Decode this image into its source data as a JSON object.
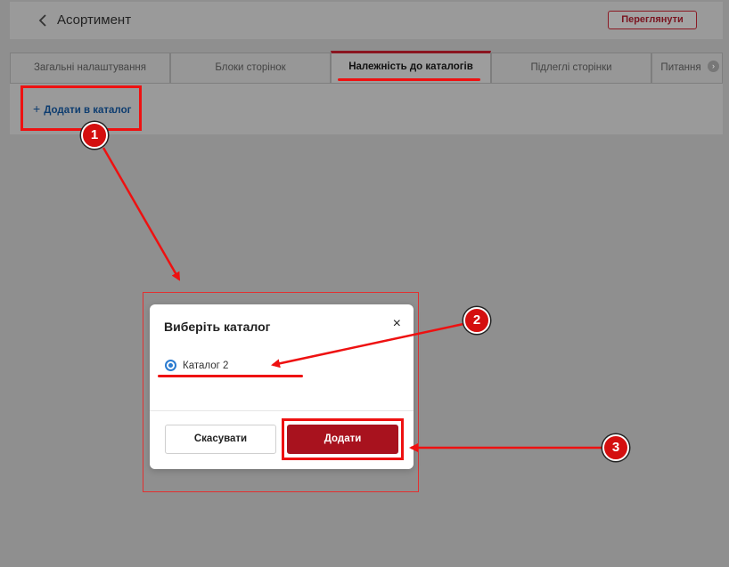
{
  "header": {
    "title": "Асортимент",
    "back_icon": "chevron-left-icon",
    "preview_label": "Переглянути"
  },
  "tabs": [
    {
      "label": "Загальні налаштування",
      "active": false
    },
    {
      "label": "Блоки сторінок",
      "active": false
    },
    {
      "label": "Належність до каталогів",
      "active": true
    },
    {
      "label": "Підлеглі сторінки",
      "active": false
    },
    {
      "label": "Питання",
      "active": false
    }
  ],
  "tab_more_icon": "chevron-right-icon",
  "panel": {
    "add_plus": "+",
    "add_label": "Додати в каталог"
  },
  "modal": {
    "title": "Виберіть каталог",
    "close_glyph": "×",
    "option_label": "Каталог 2",
    "option_selected": true,
    "cancel_label": "Скасувати",
    "confirm_label": "Додати"
  },
  "annotations": {
    "badge_1": "1",
    "badge_2": "2",
    "badge_3": "3",
    "highlight_color": "#ee1111"
  },
  "colors": {
    "accent": "#a8121e",
    "link": "#0e3d70",
    "radio": "#2a7bd0",
    "overlay": "#8f8f8f"
  }
}
